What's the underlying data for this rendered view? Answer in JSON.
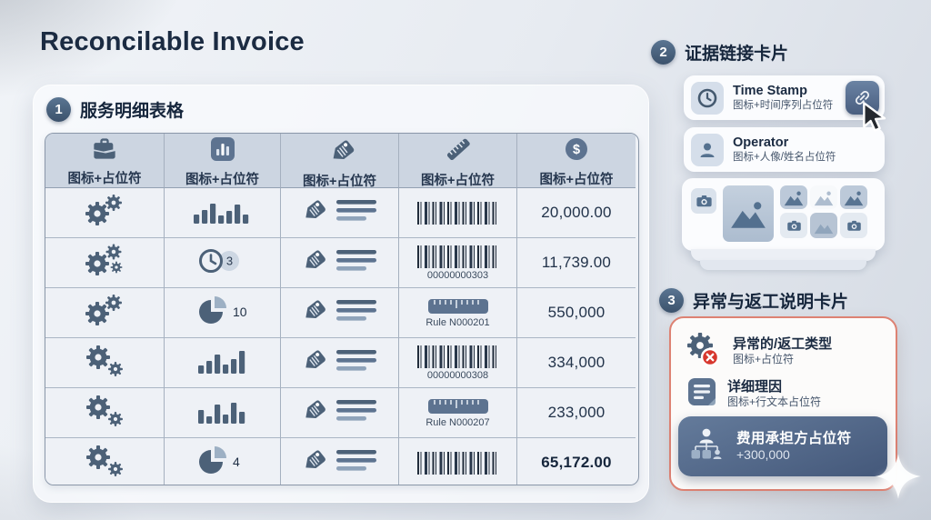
{
  "title": "Reconcilable Invoice",
  "colors": {
    "slate": "#4c6178",
    "slate_mid": "#5d7390",
    "slate_light": "#8fa3ba",
    "cell_bg": "#eef1f6",
    "badge_bg": "#cdd7e3",
    "pie_light": "#9db0c4",
    "error_red": "#d7372e",
    "card_border_red": "#dd8273"
  },
  "section1": {
    "badge": "1",
    "title": "服务明细表格",
    "header_label": "图标+占位符",
    "header_icons": [
      "briefcase-icon",
      "bar-chart-tile-icon",
      "tag-icon",
      "ruler-icon",
      "dollar-icon"
    ],
    "rows": [
      {
        "tools": "duo",
        "qty": {
          "type": "bars",
          "heights": [
            10,
            15,
            22,
            9,
            14,
            21,
            10
          ]
        },
        "code": {
          "type": "barcode",
          "label": ""
        },
        "amount": "20,000.00",
        "amount_bold": false
      },
      {
        "tools": "trio",
        "qty": {
          "type": "clock",
          "count": "3"
        },
        "code": {
          "type": "barcode",
          "label": "00000000303"
        },
        "amount": "11,739.00",
        "amount_bold": false
      },
      {
        "tools": "duo",
        "qty": {
          "type": "pie",
          "count": "10"
        },
        "code": {
          "type": "ruler",
          "label": "Rule N000201"
        },
        "amount": "550,000",
        "amount_bold": false
      },
      {
        "tools": "duo-low",
        "qty": {
          "type": "bars",
          "heights": [
            9,
            14,
            21,
            10,
            16,
            25
          ]
        },
        "code": {
          "type": "barcode",
          "label": "00000000308"
        },
        "amount": "334,000",
        "amount_bold": false
      },
      {
        "tools": "duo-low",
        "qty": {
          "type": "bars",
          "heights": [
            15,
            8,
            21,
            10,
            23,
            13
          ]
        },
        "code": {
          "type": "ruler",
          "label": "Rule N000207"
        },
        "amount": "233,000",
        "amount_bold": false
      },
      {
        "tools": "duo-low",
        "qty": {
          "type": "pie",
          "count": "4"
        },
        "code": {
          "type": "barcode",
          "label": ""
        },
        "amount": "65,172.00",
        "amount_bold": true
      }
    ]
  },
  "section2": {
    "badge": "2",
    "title": "证据链接卡片",
    "cards": [
      {
        "icon": "clock-icon",
        "title": "Time Stamp",
        "subtitle": "图标+时间序列占位符",
        "action": "link-icon"
      },
      {
        "icon": "person-icon",
        "title": "Operator",
        "subtitle": "图标+人像/姓名占位符"
      }
    ],
    "gallery_tiles": [
      "camera-icon",
      "image-icon",
      "image-icon",
      "image-icon",
      "image-icon",
      "camera-icon",
      "image-icon",
      "camera-icon"
    ]
  },
  "section3": {
    "badge": "3",
    "title": "异常与返工说明卡片",
    "items": [
      {
        "icon": "gear-error-icon",
        "title": "异常的/返工类型",
        "subtitle": "图标+占位符"
      },
      {
        "icon": "note-icon",
        "title": "详细理因",
        "subtitle": "图标+行文本占位符"
      }
    ],
    "cost_bearer": {
      "icon": "org-chart-icon",
      "title": "费用承担方占位符",
      "value": "+300,000"
    }
  }
}
